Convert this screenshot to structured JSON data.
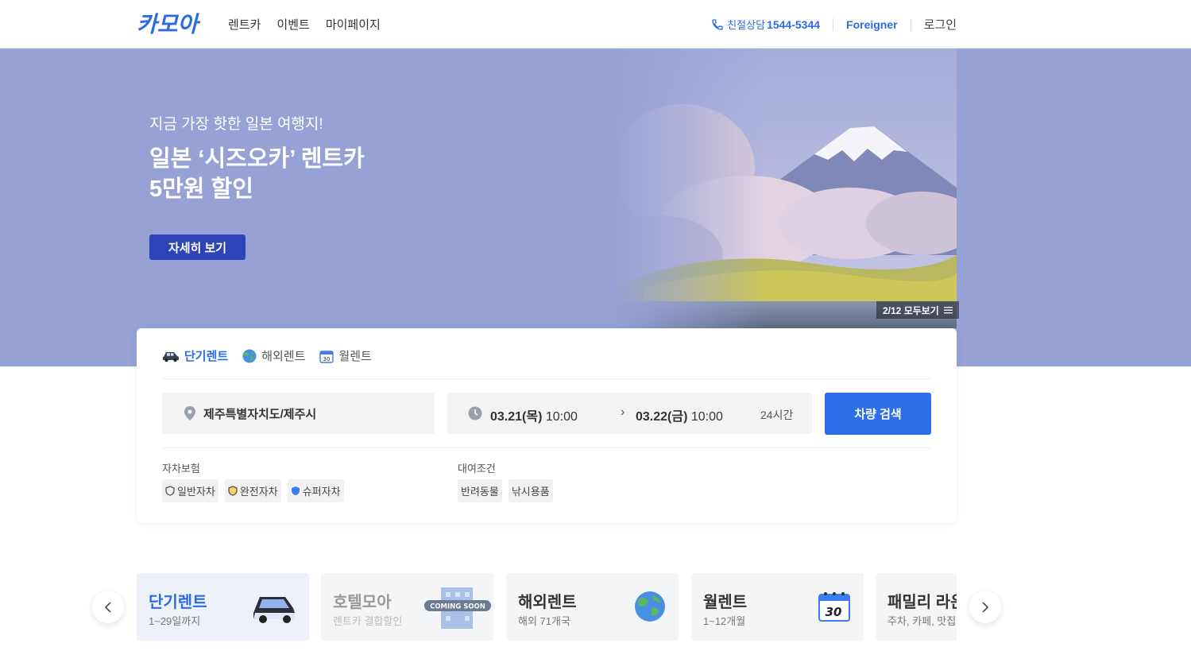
{
  "header": {
    "logo_text": "카모아",
    "nav": [
      "렌트카",
      "이벤트",
      "마이페이지"
    ],
    "cs_label": "친절상담",
    "cs_number": "1544-5344",
    "foreigner": "Foreigner",
    "login": "로그인"
  },
  "hero": {
    "subtitle": "지금 가장 핫한 일본 여행지!",
    "title_line1": "일본 ‘시즈오카’ 렌트카",
    "title_line2": "5만원 할인",
    "button": "자세히 보기",
    "counter": "2/12 모두보기",
    "bg_color": "#96a2d5"
  },
  "search": {
    "tabs": [
      "단기렌트",
      "해외렌트",
      "월렌트"
    ],
    "location": "제주특별자치도/제주시",
    "start_date": "03.21(목)",
    "start_time": "10:00",
    "end_date": "03.22(금)",
    "end_time": "10:00",
    "duration": "24시간",
    "search_button": "차량 검색",
    "insurance_label": "자차보험",
    "insurance": [
      "일반자차",
      "완전자차",
      "슈퍼자차"
    ],
    "condition_label": "대여조건",
    "conditions": [
      "반려동물",
      "낚시용품"
    ]
  },
  "categories": [
    {
      "title": "단기렌트",
      "sub": "1~29일까지"
    },
    {
      "title": "호텔모아",
      "sub": "렌트카 결합할인",
      "badge": "COMING SOON"
    },
    {
      "title": "해외렌트",
      "sub": "해외 71개국"
    },
    {
      "title": "월렌트",
      "sub": "1~12개월"
    },
    {
      "title": "패밀리 라운지",
      "sub": "주차, 카페, 맛집 할인"
    }
  ],
  "calendar_day": "30",
  "accent_color": "#2d6be4"
}
